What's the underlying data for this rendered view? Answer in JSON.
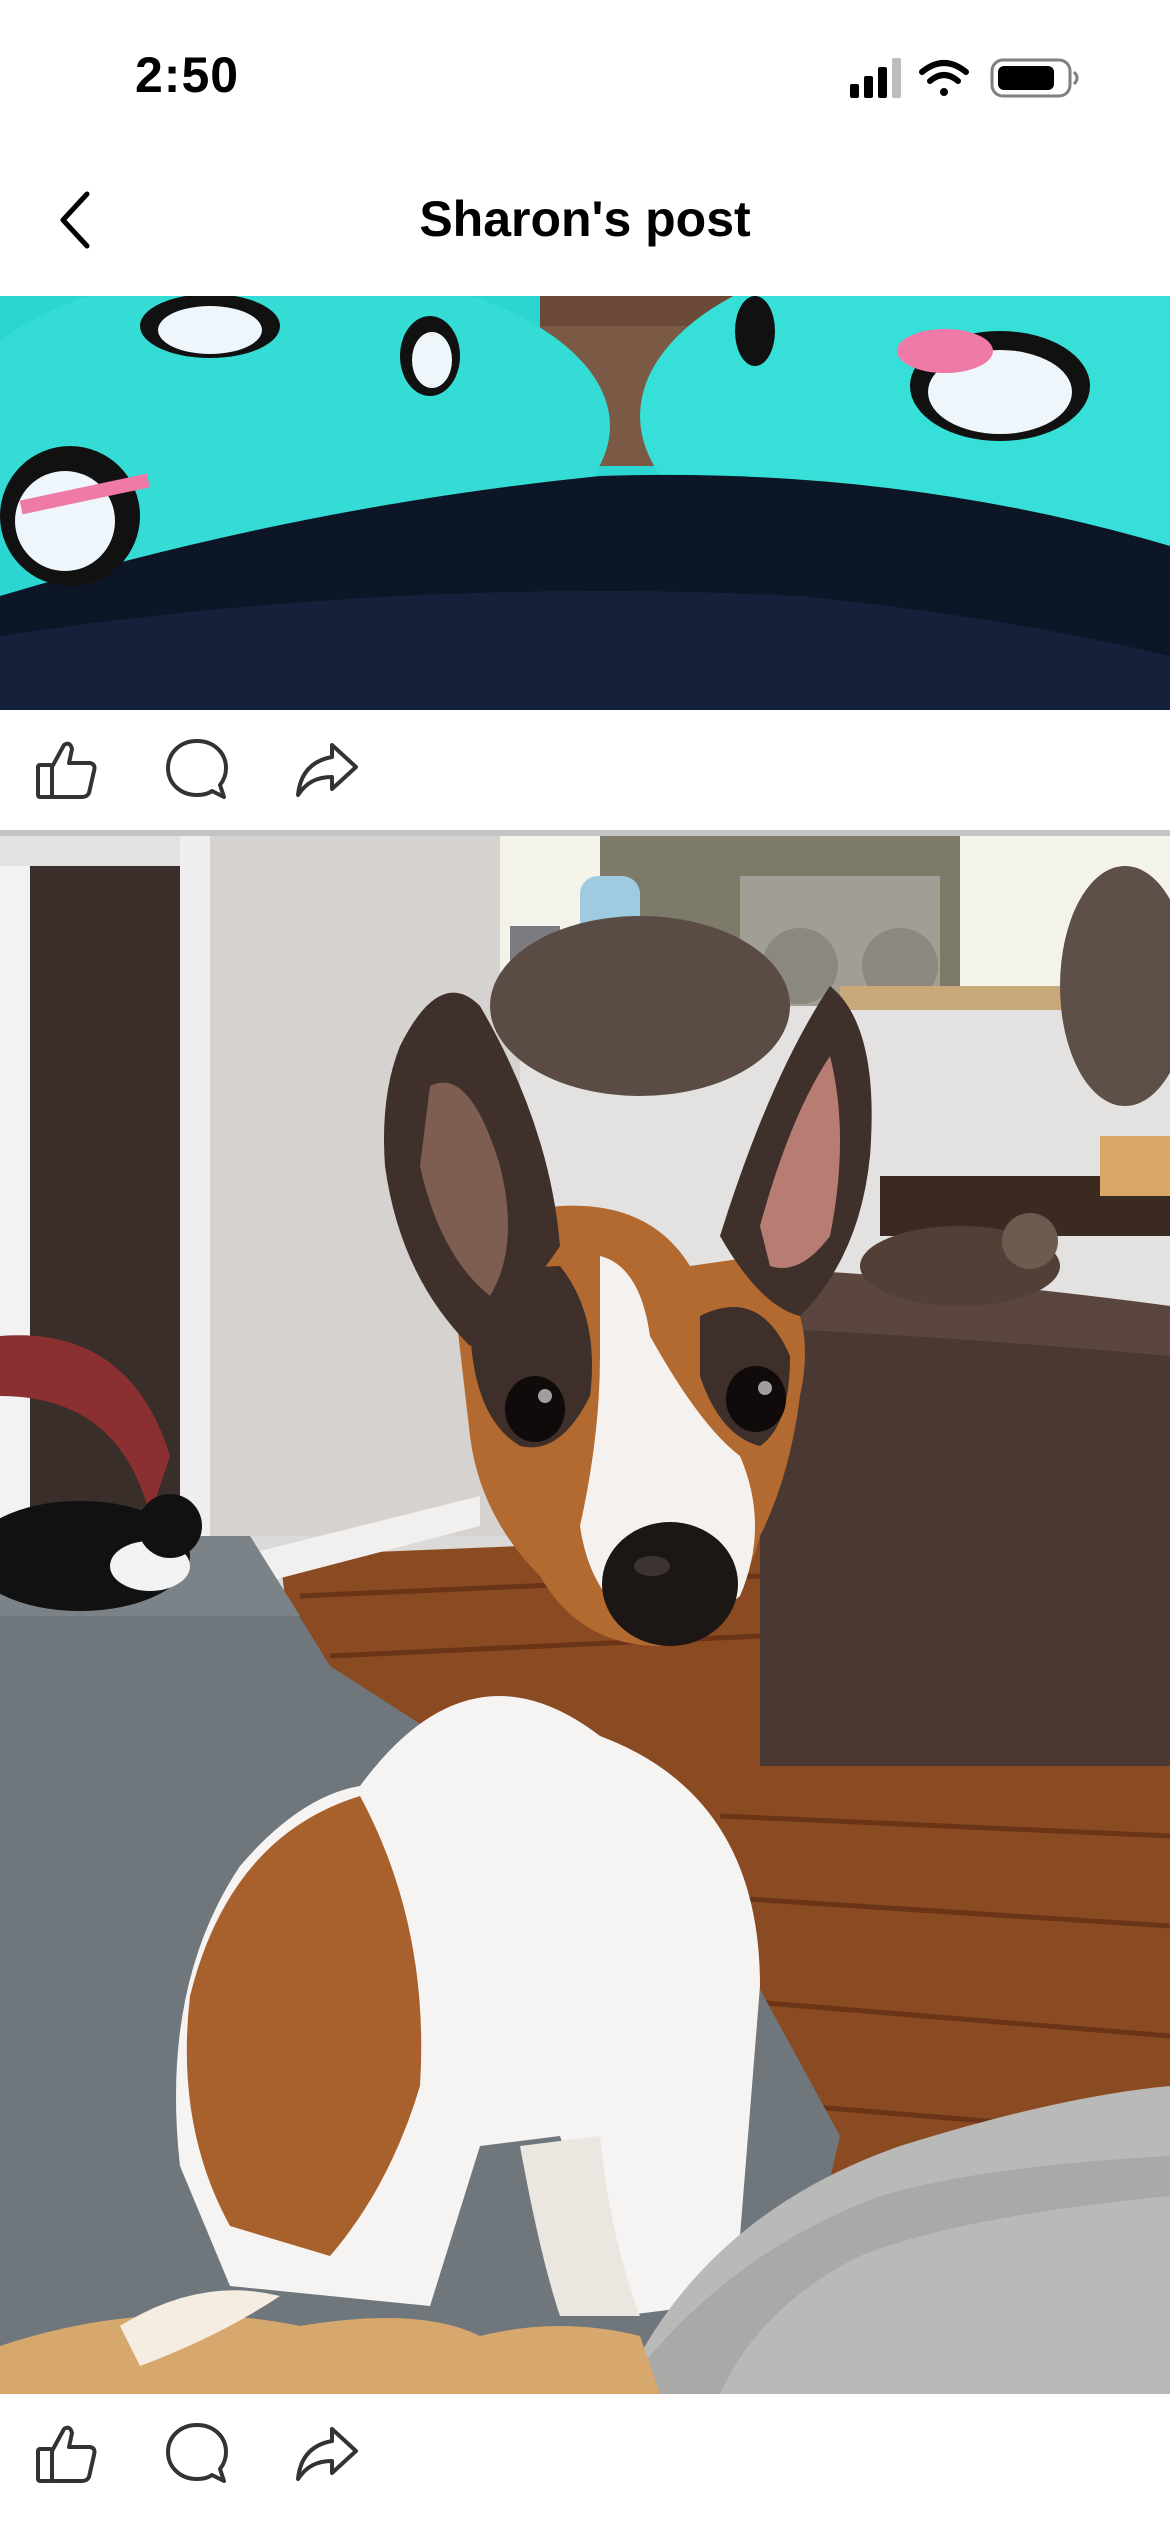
{
  "status_bar": {
    "time": "2:50",
    "icons": [
      "cellular-signal-icon",
      "wifi-icon",
      "battery-icon"
    ]
  },
  "header": {
    "title": "Sharon's post",
    "back_icon": "chevron-left-icon"
  },
  "posts": [
    {
      "photo_alt": "Legs in teal penguin-print pajama pants",
      "actions": [
        "like-icon",
        "comment-icon",
        "share-icon"
      ]
    },
    {
      "photo_alt": "Brown and white dog sitting on a couch in a living room",
      "actions": [
        "like-icon",
        "comment-icon",
        "share-icon"
      ]
    }
  ],
  "colors": {
    "icon": "#333333",
    "divider": "#c4c4c4",
    "teal": "#2ad6cf",
    "floor": "#8a4a22"
  }
}
